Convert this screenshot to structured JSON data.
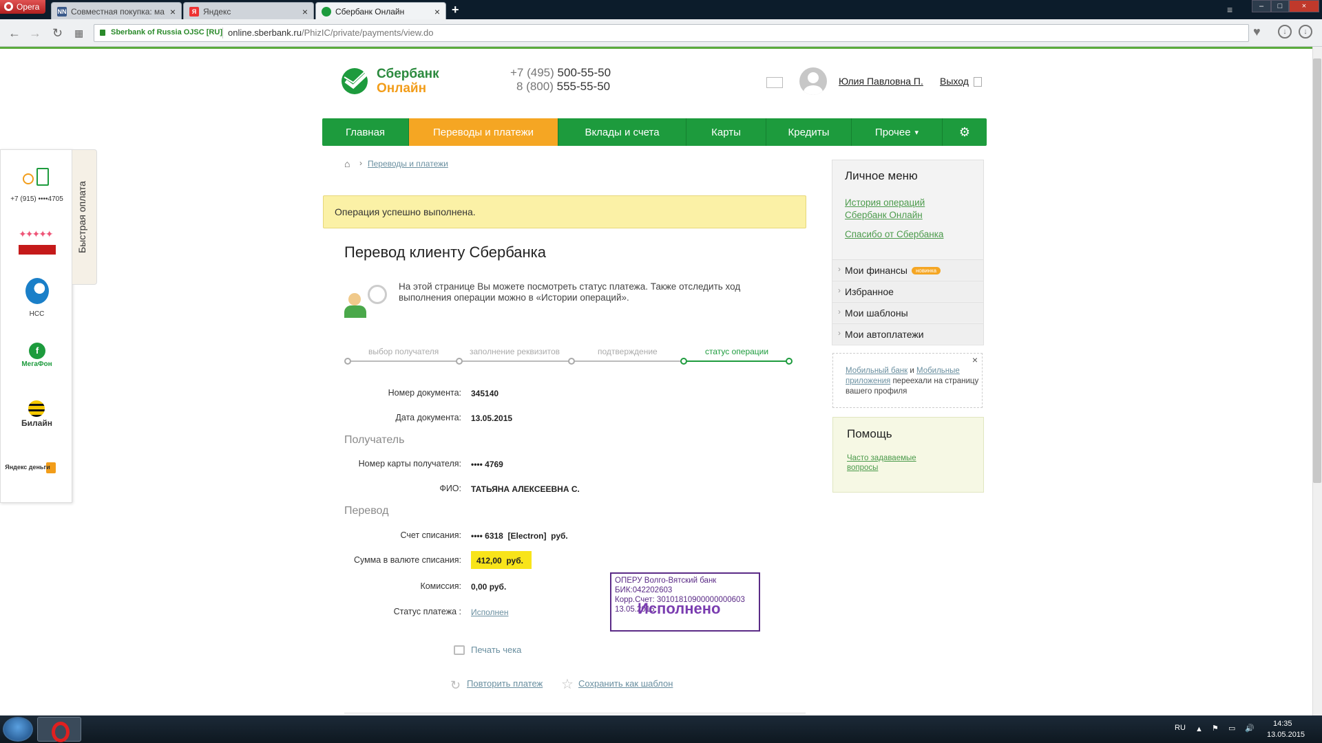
{
  "browser": {
    "opera_label": "Opera",
    "tabs": [
      {
        "title": "Совместная покупка: ма",
        "favicon": "NN"
      },
      {
        "title": "Яндекс",
        "favicon": "Я"
      },
      {
        "title": "Сбербанк Онлайн",
        "favicon": "sber"
      }
    ],
    "secure_label": "Sberbank of Russia OJSC [RU]",
    "url_host": "online.sberbank.ru",
    "url_path": "/PhizIC/private/payments/view.do"
  },
  "header": {
    "logo_line1": "Сбербанк",
    "logo_line2": "Онлайн",
    "phone1_prefix": "+7 (495)",
    "phone1_number": "500-55-50",
    "phone2_prefix": "8 (800)",
    "phone2_number": "555-55-50",
    "user_name": "Юлия Павловна П.",
    "logout": "Выход"
  },
  "nav": [
    {
      "label": "Главная"
    },
    {
      "label": "Переводы и платежи"
    },
    {
      "label": "Вклады и счета"
    },
    {
      "label": "Карты"
    },
    {
      "label": "Кредиты"
    },
    {
      "label": "Прочее"
    }
  ],
  "fastpay": {
    "tab_label": "Быстрая оплата",
    "items": [
      {
        "label": "+7 (915) ••••4705"
      },
      {
        "label": ""
      },
      {
        "label": "НСС"
      },
      {
        "label": "МегаФон"
      },
      {
        "label": "Билайн"
      },
      {
        "label": "Яндекс деньги"
      }
    ]
  },
  "breadcrumb": {
    "current": "Переводы и платежи"
  },
  "success_message": "Операция успешно выполнена.",
  "page_title": "Перевод клиенту Сбербанка",
  "description": "На этой странице Вы можете посмотреть статус платежа. Также отследить ход выполнения операции можно в «Истории операций».",
  "steps": [
    {
      "label": "выбор получателя"
    },
    {
      "label": "заполнение реквизитов"
    },
    {
      "label": "подтверждение"
    },
    {
      "label": "статус операции"
    }
  ],
  "details": {
    "doc_number_label": "Номер документа:",
    "doc_number": "345140",
    "doc_date_label": "Дата документа:",
    "doc_date": "13.05.2015",
    "recipient_section": "Получатель",
    "card_label": "Номер карты получателя:",
    "card": "•••• 4769",
    "fio_label": "ФИО:",
    "fio": "ТАТЬЯНА АЛЕКСЕЕВНА С.",
    "transfer_section": "Перевод",
    "account_label": "Счет списания:",
    "account": "•••• 6318  [Electron]  руб.",
    "amount_label": "Сумма в валюте списания:",
    "amount": "412,00  руб.",
    "fee_label": "Комиссия:",
    "fee": "0,00 руб.",
    "status_label": "Статус платежа :",
    "status": "Исполнен"
  },
  "stamp": {
    "line1": "ОПЕРУ Волго-Вятский банк",
    "line2": "БИК:042202603",
    "line3": "Корр.Счет: 30101810900000000603",
    "date": "13.05.2015",
    "big": "Исполнено"
  },
  "actions": {
    "print": "Печать чека",
    "repeat": "Повторить платеж",
    "save_template": "Сохранить как шаблон"
  },
  "personal_menu": {
    "title": "Личное меню",
    "link1": "История операций Сбербанк Онлайн",
    "link2": "Спасибо от Сбербанка",
    "rows": [
      {
        "label": "Мои финансы",
        "badge": "новинка"
      },
      {
        "label": "Избранное"
      },
      {
        "label": "Мои шаблоны"
      },
      {
        "label": "Мои автоплатежи"
      }
    ]
  },
  "notice": {
    "part1": "Мобильный банк",
    "part2": " и ",
    "part3": "Мобильные приложения",
    "part4": " переехали на страницу вашего профиля"
  },
  "help": {
    "title": "Помощь",
    "link": "Часто задаваемые вопросы"
  },
  "taskbar": {
    "lang": "RU",
    "time": "14:35",
    "date": "13.05.2015"
  },
  "colors": {
    "sber_green": "#1d9b3d",
    "active_orange": "#f5a623",
    "highlight_yellow": "#f8e41a",
    "stamp_purple": "#5a2a86"
  }
}
